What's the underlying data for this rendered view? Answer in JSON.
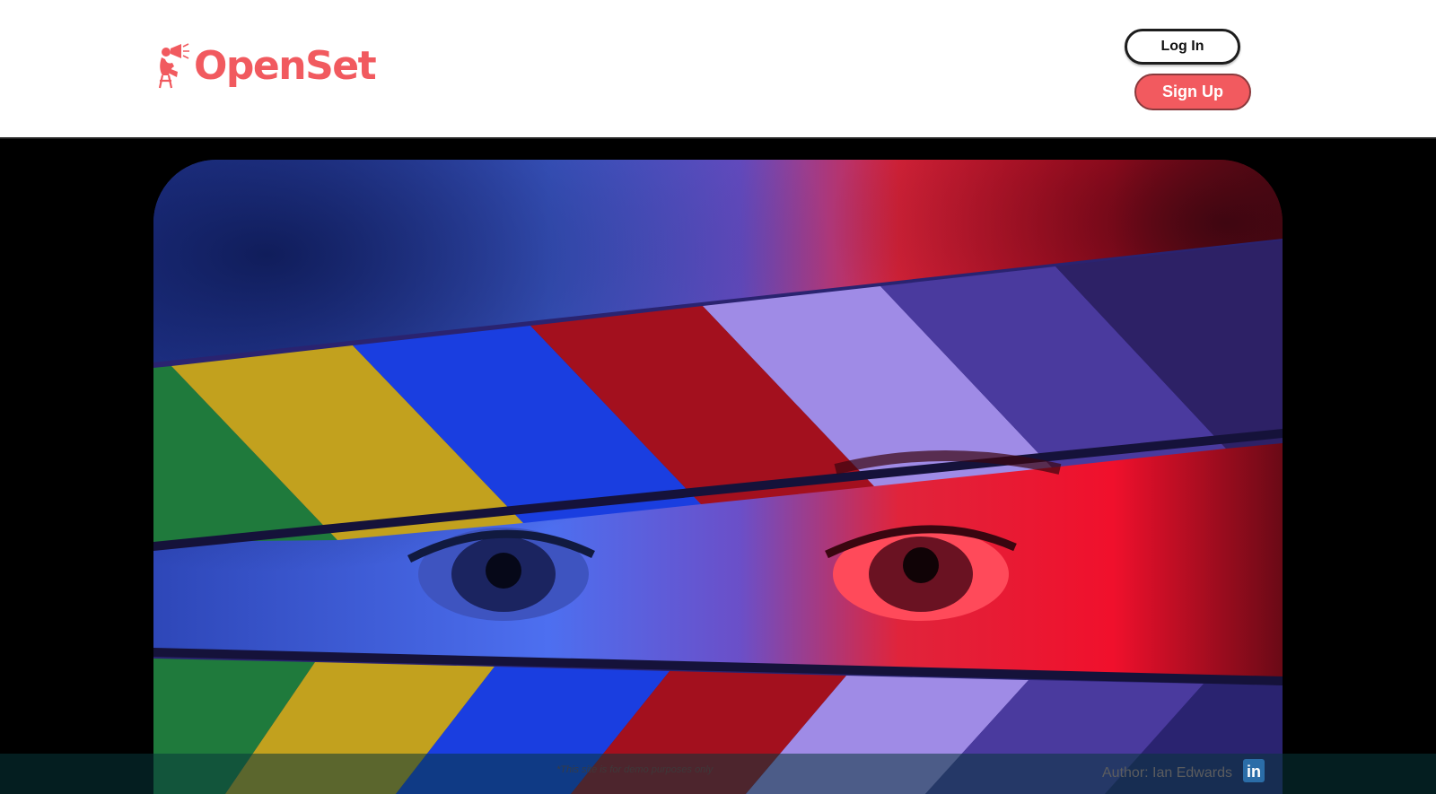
{
  "header": {
    "logo_text": "OpenSet",
    "login_label": "Log In",
    "signup_label": "Sign Up"
  },
  "hero": {
    "image": "clapperboard-portrait-image"
  },
  "footer": {
    "demo_note": "*This site is for demo purposes only",
    "author": "Author: Ian Edwards",
    "linkedin_icon": "linkedin-icon",
    "linkedin_glyph": "in"
  },
  "colors": {
    "brand": "#f15a5f",
    "signup_bg": "#f25a5f",
    "linkedin": "#2b6da8"
  }
}
